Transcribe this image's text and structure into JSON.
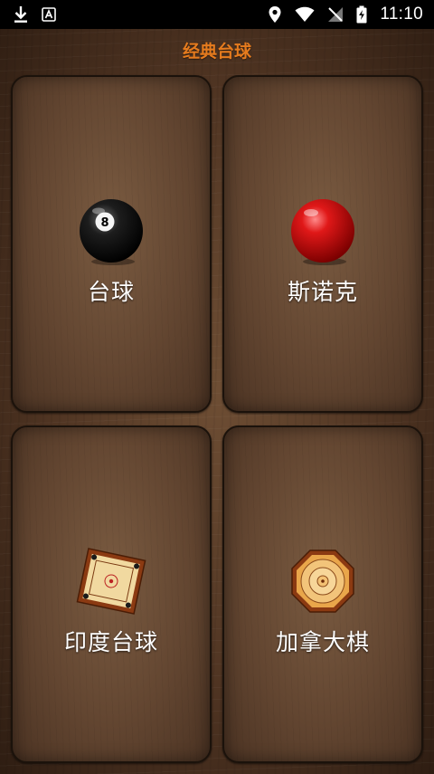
{
  "status_bar": {
    "time": "11:10",
    "icons": [
      "download-icon",
      "text-a-icon",
      "location-icon",
      "wifi-icon",
      "no-signal-icon",
      "battery-charging-icon"
    ]
  },
  "header": {
    "title": "经典台球"
  },
  "games": [
    {
      "label": "台球",
      "icon": "eight-ball-icon"
    },
    {
      "label": "斯诺克",
      "icon": "red-snooker-ball-icon"
    },
    {
      "label": "印度台球",
      "icon": "carrom-board-icon"
    },
    {
      "label": "加拿大棋",
      "icon": "crokinole-board-icon"
    }
  ],
  "colors": {
    "title_accent": "#e57b1e",
    "background": "#4f3422",
    "tile_border": "#1b120b"
  }
}
